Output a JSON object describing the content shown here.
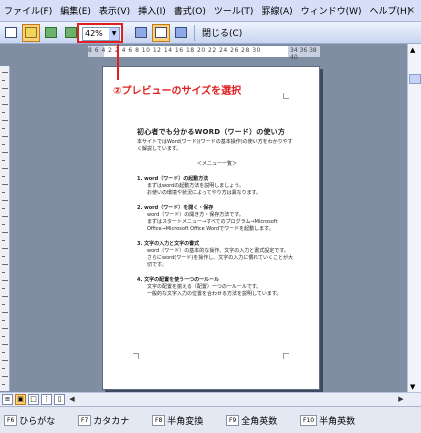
{
  "menubar": {
    "items": [
      "ファイル(F)",
      "編集(E)",
      "表示(V)",
      "挿入(I)",
      "書式(O)",
      "ツール(T)",
      "罫線(A)",
      "ウィンドウ(W)",
      "ヘルプ(H)"
    ]
  },
  "toolbar": {
    "zoom_value": "42%",
    "close_label": "閉じる(C)"
  },
  "ruler": {
    "labels": "8 6 4 2 2 4 6 8 10 12 14 16 18 20 22 24 26 28 30"
  },
  "ruler_right": {
    "labels": "34 36 38 40"
  },
  "callout": {
    "text": "②プレビューのサイズを選択"
  },
  "document": {
    "title": "初心者でも分かるWORD（ワード）の使い方",
    "intro": "本サイトではWord(ワード)(ワードの基本操作)の使い方をわかりやすく解説しています。",
    "menu": "＜メニュー一覧＞",
    "sections": [
      {
        "heading": "1. word（ワード）の起動方法",
        "lines": [
          "まずはwordの起動方法を説明しましょう。",
          "お使いの環境や状況によってやり方は異なります。"
        ]
      },
      {
        "heading": "2. word（ワード）を開く・保存",
        "lines": [
          "word（ワード）の開き方・保存方法です。",
          "まずはスタートメニュー→すべてのプログラム→Microsoft Office→Microsoft Office Wordでワードを起動します。"
        ]
      },
      {
        "heading": "3. 文字の入力と文字の書式",
        "lines": [
          "word（ワード）の基本的な操作、文字の入力と書式設定です。",
          "さらにword(ワード)を操作し、文字の入力に慣れていくことが大切です。"
        ]
      },
      {
        "heading": "4. 文字の配置を使う一つの一ルール",
        "lines": [
          "文字の配置を揃える（配置）一つの一ルールです。",
          "一般的な文字入力の位置を合わせる方法を説明しています。"
        ]
      }
    ]
  },
  "statusbar": {
    "keys": [
      {
        "key": "F6",
        "label": "ひらがな"
      },
      {
        "key": "F7",
        "label": "カタカナ"
      },
      {
        "key": "F8",
        "label": "半角変換"
      },
      {
        "key": "F9",
        "label": "全角英数"
      },
      {
        "key": "F10",
        "label": "半角英数"
      }
    ]
  },
  "icons": {
    "print": "print-icon",
    "magnifier": "magnifier-icon",
    "one_page": "one-page-icon",
    "multiple_pages": "multiple-pages-icon",
    "view_ruler": "view-ruler-icon",
    "shrink": "shrink-to-fit-icon",
    "full_screen": "full-screen-icon"
  },
  "colors": {
    "callout_red": "#e02020",
    "chrome_blue": "#d6dff7",
    "workspace": "#7f8ea3"
  }
}
